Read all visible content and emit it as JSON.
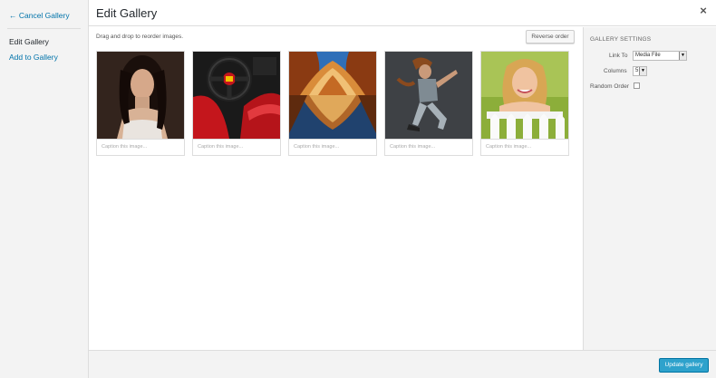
{
  "menu": {
    "cancel_label": "← Cancel Gallery",
    "items": [
      {
        "label": "Edit Gallery",
        "active": true
      },
      {
        "label": "Add to Gallery",
        "active": false
      }
    ]
  },
  "header": {
    "title": "Edit Gallery",
    "close_symbol": "×"
  },
  "content": {
    "instructions": "Drag and drop to reorder images.",
    "reverse_label": "Reverse order"
  },
  "images": [
    {
      "caption_placeholder": "Caption this image...",
      "icon": "portrait-woman-photo"
    },
    {
      "caption_placeholder": "Caption this image...",
      "icon": "car-interior-photo"
    },
    {
      "caption_placeholder": "Caption this image...",
      "icon": "canyon-landscape-photo"
    },
    {
      "caption_placeholder": "Caption this image...",
      "icon": "dancer-photo"
    },
    {
      "caption_placeholder": "Caption this image...",
      "icon": "smiling-woman-fence-photo"
    }
  ],
  "settings": {
    "heading": "Gallery Settings",
    "link_to": {
      "label": "Link To",
      "value": "Media File"
    },
    "columns": {
      "label": "Columns",
      "value": "5"
    },
    "random_order": {
      "label": "Random Order",
      "checked": false
    }
  },
  "footer": {
    "update_label": "Update gallery"
  },
  "colors": {
    "accent": "#0073aa",
    "button_primary": "#2ea2cc",
    "panel_bg": "#f3f3f3",
    "border": "#dddddd"
  }
}
